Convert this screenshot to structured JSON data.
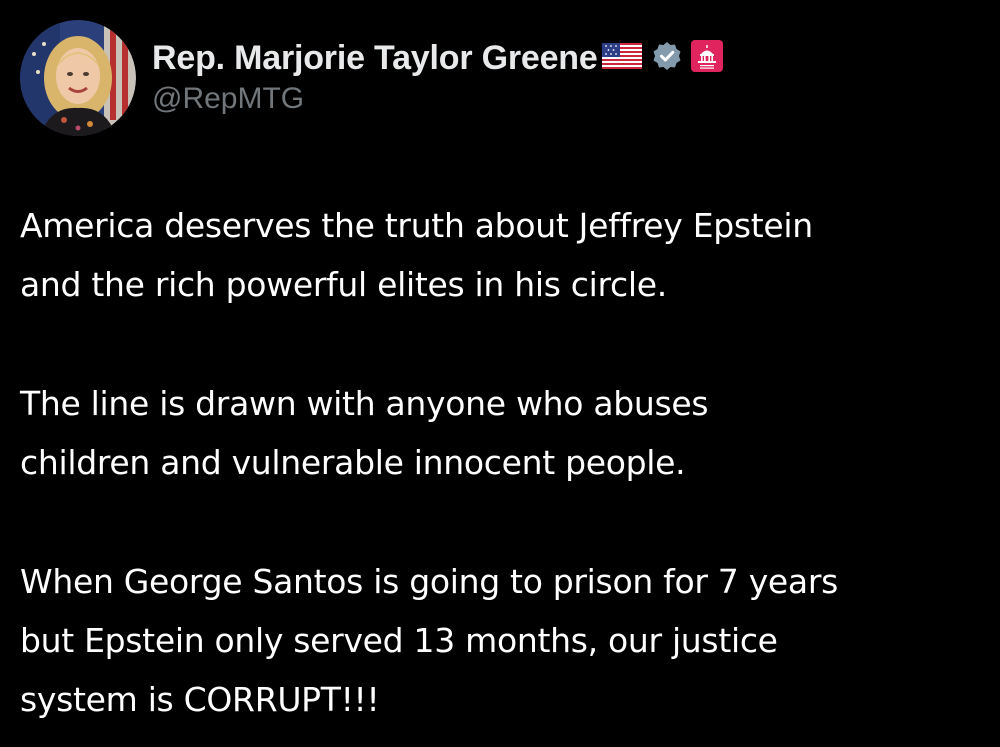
{
  "tweet": {
    "author": {
      "display_name": "Rep. Marjorie Taylor Greene",
      "handle": "@RepMTG",
      "avatar": "avatar-photo",
      "badges": [
        "us-flag-icon",
        "verified-badge-icon",
        "government-capitol-icon"
      ]
    },
    "colors": {
      "background": "#000000",
      "text": "#ffffff",
      "handle": "#71767b",
      "verified": "#829aab",
      "gov_badge": "#e0245e"
    },
    "paragraphs": [
      "America deserves the truth about Jeffrey Epstein\nand the rich powerful elites in his circle.",
      "The line is drawn with anyone who abuses\nchildren and vulnerable innocent people.",
      "When George Santos is going to prison for 7 years\nbut Epstein only served 13 months, our justice\nsystem is CORRUPT!!!"
    ]
  }
}
